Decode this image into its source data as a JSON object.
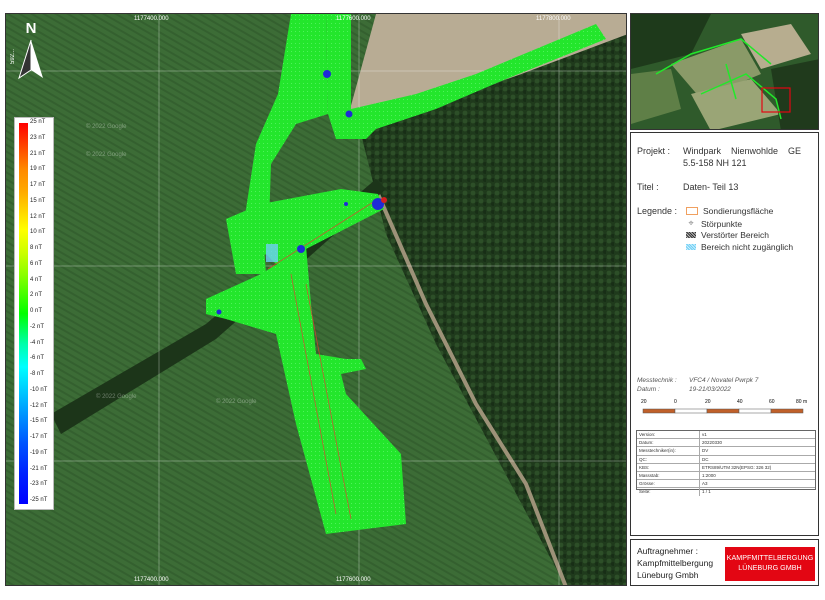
{
  "map": {
    "coords_top": [
      "1177400.000",
      "1177600.000",
      "1177800.000"
    ],
    "coords_bottom": [
      "1177400.000",
      "1177600.000"
    ],
    "coords_left": [
      "592...",
      "4000.000"
    ],
    "north_label": "N",
    "watermarks": [
      "© 2022 Google",
      "© 2022 Google",
      "© 2022 Google",
      "© 2022 Google"
    ],
    "colors": {
      "survey_area": "#22e82a",
      "field": "#3a6a35",
      "forest": "#213a1e",
      "bare_field": "#b6a991"
    }
  },
  "color_scale": {
    "labels": [
      "25 nT",
      "23 nT",
      "21 nT",
      "19 nT",
      "17 nT",
      "15 nT",
      "12 nT",
      "10 nT",
      "8 nT",
      "6 nT",
      "4 nT",
      "2 nT",
      "0 nT",
      "-2 nT",
      "-4 nT",
      "-6 nT",
      "-8 nT",
      "-10 nT",
      "-12 nT",
      "-15 nT",
      "-17 nT",
      "-19 nT",
      "-21 nT",
      "-23 nT",
      "-25 nT"
    ]
  },
  "info": {
    "projekt_label": "Projekt :",
    "projekt_value_1": "Windpark    Nienwohlde    GE",
    "projekt_value_2": "5.5-158 NH 121",
    "titel_label": "Titel :",
    "titel_value": "Daten- Teil 13",
    "legende_label": "Legende :",
    "legend": [
      {
        "label": "Sondierungsfläche",
        "color": "#f0a060"
      },
      {
        "label": "Störpunkte",
        "color": "#888888"
      },
      {
        "label": "Verstörter Bereich",
        "color": "#333333"
      },
      {
        "label": "Bereich nicht zugänglich",
        "color": "#6ecff6"
      }
    ],
    "messtechnik_label": "Messtechnik :",
    "messtechnik_value": "VFC4 / Novatel Pwrpk 7",
    "datum_label": "Datum :",
    "datum_value": "19-21/03/2022",
    "scale_ticks": [
      "20",
      "0",
      "20",
      "40",
      "60",
      "80 m"
    ],
    "meta_rows": [
      {
        "k": "Version:",
        "v": "v1"
      },
      {
        "k": "Datum:",
        "v": "20220330"
      },
      {
        "k": "Messtechniker(in):",
        "v": "DV"
      },
      {
        "k": "QC:",
        "v": "DC"
      },
      {
        "k": "KBS:",
        "v": "ETRS89/UTM 32N(EPSG: 326 32)"
      },
      {
        "k": "Massstab:",
        "v": "1:2000"
      },
      {
        "k": "Grösse:",
        "v": "A3"
      },
      {
        "k": "Seite:",
        "v": "1 / 1"
      }
    ]
  },
  "contractor": {
    "label": "Auftragnehmer :",
    "name_1": "Kampfmittelbergung",
    "name_2": "Lüneburg Gmbh",
    "logo_line_1": "KAMPFMITTELBERGUNG",
    "logo_line_2": "LÜNEBURG GMBH",
    "logo_color": "#e30613"
  }
}
